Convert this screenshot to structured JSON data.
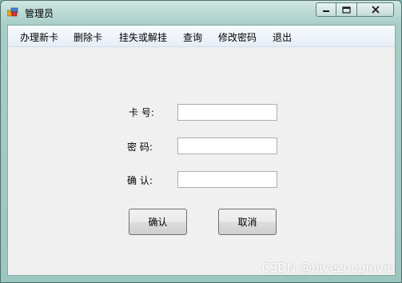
{
  "window": {
    "title": "管理员"
  },
  "window_controls": {
    "minimize_icon": "minimize-icon",
    "maximize_icon": "maximize-icon",
    "close_icon": "close-icon"
  },
  "menu": {
    "items": [
      "办理新卡",
      "删除卡",
      "挂失或解挂",
      "查询",
      "修改密码",
      "退出"
    ]
  },
  "form": {
    "card_label": "卡 号:",
    "password_label": "密 码:",
    "confirm_label": "确 认:",
    "card_value": "",
    "password_value": "",
    "confirm_value": "",
    "ok_button": "确认",
    "cancel_button": "取消"
  },
  "watermark": "CSDN @biyezuopinvip",
  "colors": {
    "client_bg": "#f0f0f0",
    "frame": "#9bc6c0",
    "menubar_top": "#f8fbfe",
    "menubar_bottom": "#e6edf6"
  }
}
